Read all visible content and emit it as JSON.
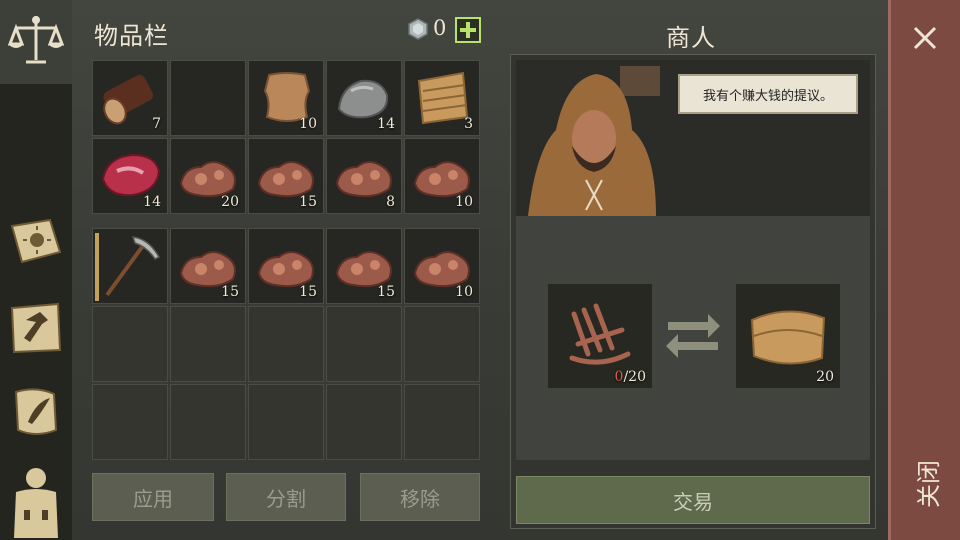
{
  "inventory": {
    "title": "物品栏",
    "currency_value": "0",
    "slots_row1": [
      {
        "item": "log",
        "count": "7"
      },
      {
        "item": "empty",
        "count": ""
      },
      {
        "item": "leather",
        "count": "10"
      },
      {
        "item": "stone",
        "count": "14"
      },
      {
        "item": "rope",
        "count": "3"
      }
    ],
    "slots_row2": [
      {
        "item": "raw-meat",
        "count": "14"
      },
      {
        "item": "copper-ore",
        "count": "20"
      },
      {
        "item": "copper-ore",
        "count": "15"
      },
      {
        "item": "copper-ore",
        "count": "8"
      },
      {
        "item": "copper-ore",
        "count": "10"
      }
    ],
    "slots_row3": [
      {
        "item": "pickaxe",
        "count": ""
      },
      {
        "item": "copper-ore",
        "count": "15"
      },
      {
        "item": "copper-ore",
        "count": "15"
      },
      {
        "item": "copper-ore",
        "count": "15"
      },
      {
        "item": "copper-ore",
        "count": "10"
      }
    ],
    "buttons": {
      "use": "应用",
      "split": "分割",
      "remove": "移除"
    }
  },
  "merchant": {
    "title": "商人",
    "speech": "我有个赚大钱的提议。",
    "give": {
      "item": "copper-rods",
      "have": "0",
      "need": "/20"
    },
    "receive": {
      "item": "cloth",
      "count": "20"
    },
    "trade_label": "交易"
  },
  "close": {
    "label": "关闭"
  },
  "colors": {
    "accent_green": "#b7e36a",
    "red_count": "#e05a4a",
    "close_bg": "#7d4a42"
  }
}
